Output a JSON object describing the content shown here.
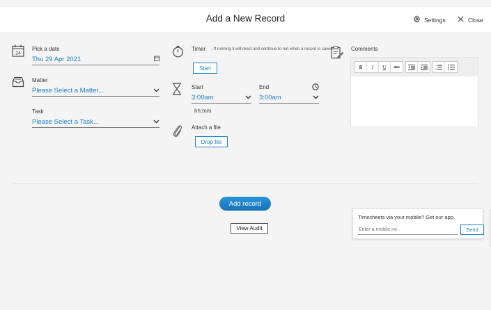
{
  "header": {
    "title": "Add a New Record",
    "settings_label": "Settings",
    "close_label": "Close"
  },
  "date": {
    "label": "Pick a date",
    "value": "Thu  29 Apr 2021",
    "calendar_day": "24"
  },
  "matter": {
    "label": "Matter",
    "value": "Please Select a Matter..."
  },
  "task": {
    "label": "Task",
    "value": "Please Select a Task..."
  },
  "timer": {
    "label": "Timer",
    "note": "- If running it will reset and continue to run when a record is saved",
    "start_button": "Start"
  },
  "start_time": {
    "label": "Start",
    "value": "3:00am",
    "hint": "hh:mm"
  },
  "end_time": {
    "label": "End",
    "value": "3:00am"
  },
  "attach": {
    "label": "Attach a file",
    "button": "Drop file"
  },
  "comments": {
    "label": "Comments",
    "toolbar": [
      "B",
      "I",
      "U",
      "abc",
      "outdent",
      "indent",
      "ordered-list",
      "bullet-list"
    ]
  },
  "actions": {
    "add_record": "Add record",
    "view_audit": "View Audit"
  },
  "mobile": {
    "title": "Timesheets via your mobile? Get our app.",
    "placeholder": "Enter a mobile no",
    "send": "Send"
  },
  "colors": {
    "accent": "#1a7fc4",
    "primary_button": "#1e80c6",
    "background": "#f4f4f4"
  }
}
